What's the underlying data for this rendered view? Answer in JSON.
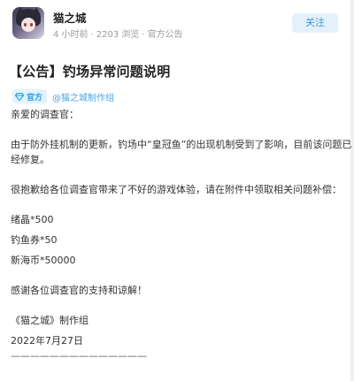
{
  "author": {
    "name": "猫之城",
    "time": "4 小时前",
    "views": "2203 浏览",
    "category": "官方公告",
    "follow_label": "关注"
  },
  "post": {
    "title": "【公告】钓场异常问题说明",
    "badge_label": "官方",
    "team_link": "@猫之城制作组",
    "greeting": "亲爱的调查官：",
    "para1_line1": "由于防外挂机制的更新，钓场中“皇冠鱼”的出现机制受到了影响，目前该问题已",
    "para1_line2": "经修复。",
    "para2": "很抱歉给各位调查官带来了不好的游戏体验，请在附件中领取相关问题补偿：",
    "reward1": "绪晶*500",
    "reward2": "钓鱼券*50",
    "reward3": "新海币*50000",
    "thanks": "感谢各位调查官的支持和谅解！",
    "signature": "《猫之城》制作组",
    "date": "2022年7月27日",
    "divider": "——————————————"
  },
  "colors": {
    "accent": "#3a9ad9",
    "follow_bg": "#e4f1fb",
    "badge_bg": "#e3f3fd",
    "meta_gray": "#9a9aa2"
  },
  "icons": {
    "badge": "diamond-icon"
  }
}
